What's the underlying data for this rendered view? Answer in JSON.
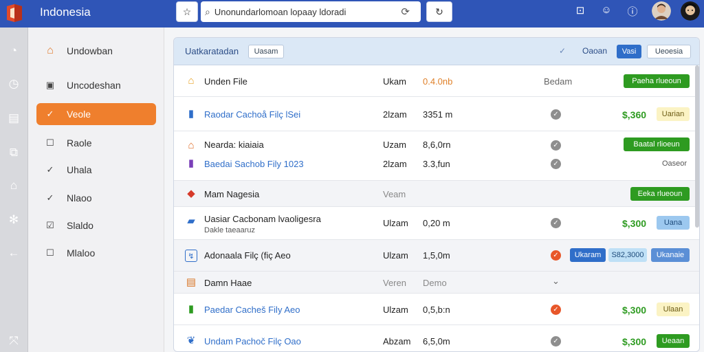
{
  "app": {
    "title": "Indonesia"
  },
  "search": {
    "value": "Unonundarlomoan lopaay ldoradi"
  },
  "nav": {
    "items": [
      {
        "label": "Undowban",
        "icon": "home-icon"
      },
      {
        "label": "Uncodeshan",
        "icon": "book-icon"
      },
      {
        "label": "Veole",
        "icon": "check-icon",
        "active": true
      },
      {
        "label": "Raole",
        "icon": "checkbox-icon"
      },
      {
        "label": "Uhala",
        "icon": "check-icon"
      },
      {
        "label": "Nlaoo",
        "icon": "check-icon"
      },
      {
        "label": "Slaldo",
        "icon": "checkbox-icon"
      },
      {
        "label": "Mlaloo",
        "icon": "checkbox-icon"
      }
    ]
  },
  "main": {
    "title": "Uatkaratadan",
    "title_badge": "Uasam",
    "header_label": "Oaoan",
    "header_btn_active": "Vasi",
    "header_btn": "Ueoesia"
  },
  "rows": [
    {
      "name": "Unden File",
      "col2": "Ukam",
      "col3": "0.4.0nb",
      "extra": "Bedam",
      "action": "Paeha rlueoun"
    },
    {
      "name": "Raodar Cachoå Filç lSei",
      "col2": "2lzam",
      "col3": "3351 m",
      "price": "$,360",
      "tag": "Uarian"
    },
    {
      "name": "Nearda: kiaiaia",
      "col2": "Uzam",
      "col3": "8,6,0rn",
      "action": "Baatal rlioeun"
    },
    {
      "name": "Baedai Sachob Fily 1023",
      "col2": "2lzam",
      "col3": "3.3,fun",
      "extra": "Oaseor"
    },
    {
      "name": "Mam Nagesia",
      "col2": "Veam",
      "action": "Eeka rlueoun"
    },
    {
      "name": "Uasiar Cacbonam lvaoligesra",
      "sub": "Dakle taeaaruz",
      "col2": "Ulzam",
      "col3": "0,20 m",
      "price": "$,300",
      "tag": "Uana"
    },
    {
      "name": "Adonaala Filç (fiç Aeo",
      "col2": "Ulzam",
      "col3": "1,5,0m",
      "btn1": "Ukaram",
      "btn2": "S82,3000",
      "btn3": "Ukanaie"
    },
    {
      "name": "Damn Haae",
      "col2": "Veren",
      "col3": "Demo"
    },
    {
      "name": "Paedar Cacheš Fily Aeo",
      "col2": "Ulzam",
      "col3": "0,5,b:n",
      "price": "$,300",
      "tag": "Ulaan"
    },
    {
      "name": "Undam Pachoč Filç Oao",
      "col2": "Abzam",
      "col3": "6,5,0m",
      "price": "$,300",
      "tag": "Ueaan"
    }
  ],
  "colors": {
    "topbar": "#2f55b7",
    "accent": "#ef7f2d",
    "green": "#2e9b21"
  }
}
